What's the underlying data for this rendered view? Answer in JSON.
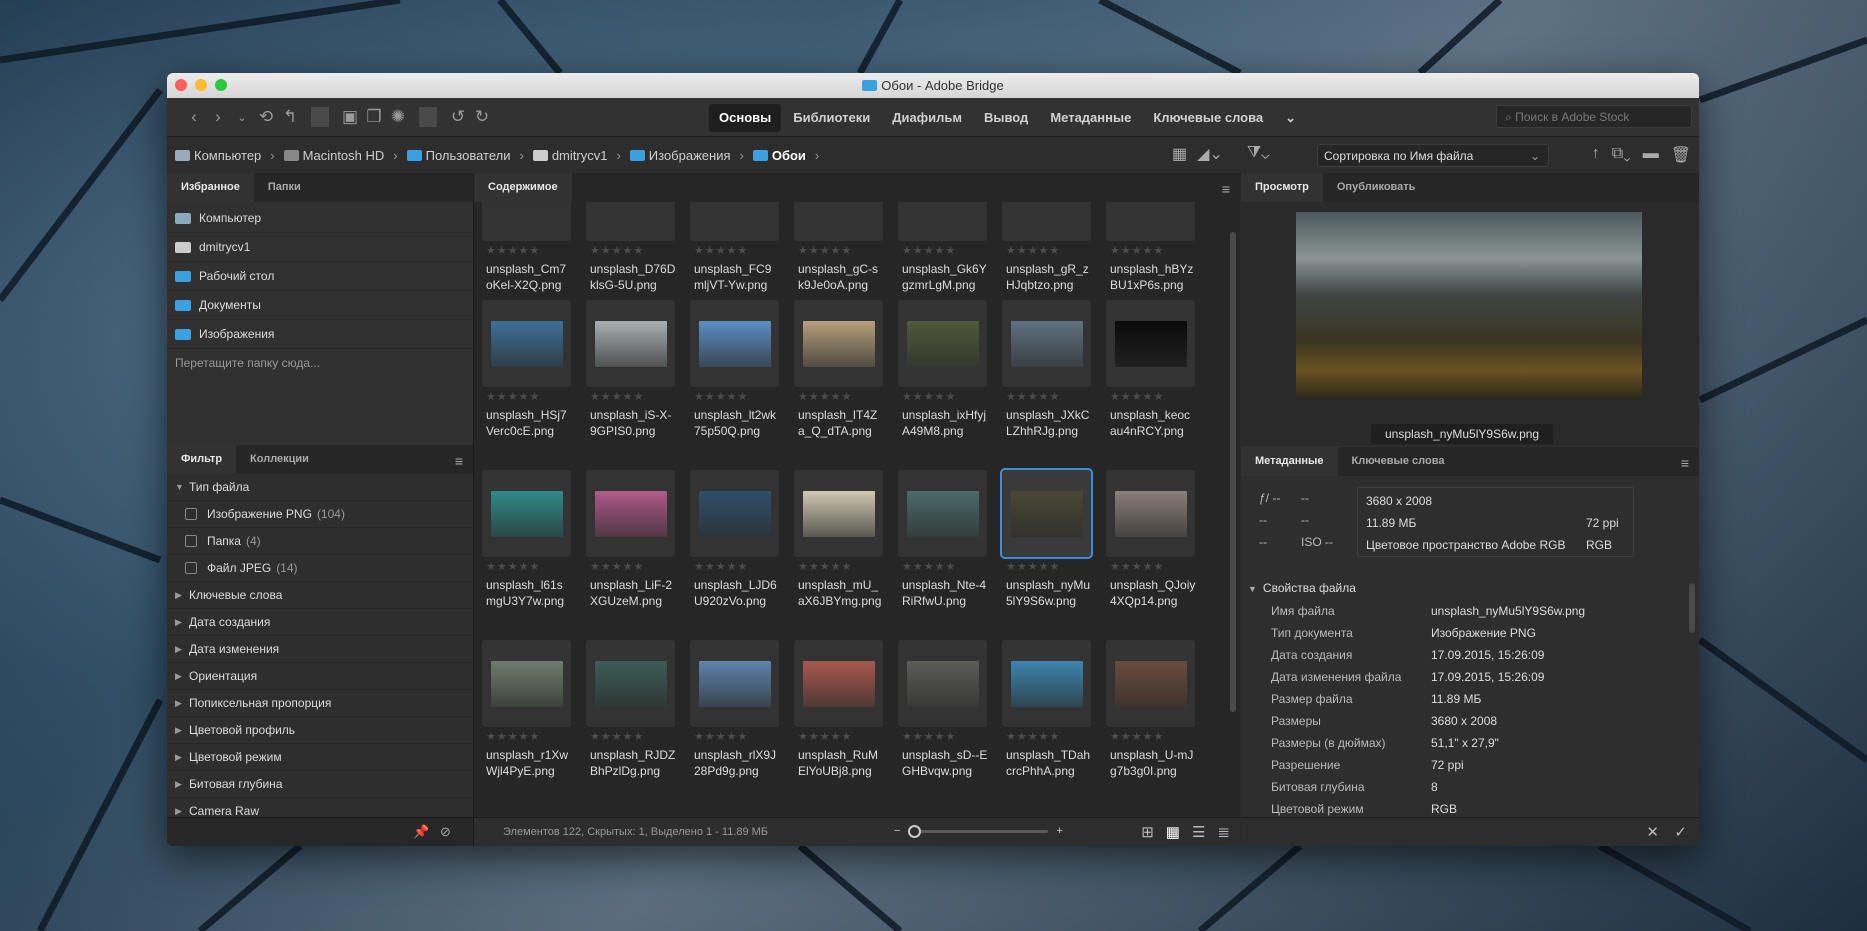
{
  "window_title": "Обои - Adobe Bridge",
  "toolbar": {
    "workspaces": [
      "Основы",
      "Библиотеки",
      "Диафильм",
      "Вывод",
      "Метаданные",
      "Ключевые слова"
    ],
    "search_placeholder": "Поиск в Adobe Stock"
  },
  "path": {
    "crumbs": [
      "Компьютер",
      "Macintosh HD",
      "Пользователи",
      "dmitrycv1",
      "Изображения",
      "Обои"
    ],
    "sort_label": "Сортировка по Имя файла"
  },
  "left": {
    "tabs": [
      "Избранное",
      "Папки"
    ],
    "favorites": [
      "Компьютер",
      "dmitrycv1",
      "Рабочий стол",
      "Документы",
      "Изображения"
    ],
    "drop_hint": "Перетащите папку сюда...",
    "filter_tabs": [
      "Фильтр",
      "Коллекции"
    ],
    "filter_section": "Тип файла",
    "filter_items": [
      {
        "label": "Изображение PNG",
        "count": "(104)"
      },
      {
        "label": "Папка",
        "count": "(4)"
      },
      {
        "label": "Файл JPEG",
        "count": "(14)"
      }
    ],
    "filter_groups": [
      "Ключевые слова",
      "Дата создания",
      "Дата изменения",
      "Ориентация",
      "Попиксельная пропорция",
      "Цветовой профиль",
      "Цветовой режим",
      "Битовая глубина",
      "Camera Raw"
    ]
  },
  "center": {
    "tab": "Содержимое",
    "rows": [
      [
        "unsplash_Cm7oKel-X2Q.png",
        "unsplash_D76DklsG-5U.png",
        "unsplash_FC9mljVT-Yw.png",
        "unsplash_gC-sk9Je0oA.png",
        "unsplash_Gk6YgzmrLgM.png",
        "unsplash_gR_zHJqbtzo.png",
        "unsplash_hBYzBU1xP6s.png"
      ],
      [
        "unsplash_HSj7Verc0cE.png",
        "unsplash_iS-X-9GPIS0.png",
        "unsplash_lt2wk75p50Q.png",
        "unsplash_IT4Za_Q_dTA.png",
        "unsplash_ixHfyjA49M8.png",
        "unsplash_JXkCLZhhRJg.png",
        "unsplash_keocau4nRCY.png"
      ],
      [
        "unsplash_l61smgU3Y7w.png",
        "unsplash_LiF-2XGUzeM.png",
        "unsplash_LJD6U920zVo.png",
        "unsplash_mU_aX6JBYmg.png",
        "unsplash_Nte-4RiRfwU.png",
        "unsplash_nyMu5lY9S6w.png",
        "unsplash_QJoiy4XQp14.png"
      ],
      [
        "unsplash_r1XwWjl4PyE.png",
        "unsplash_RJDZBhPzlDg.png",
        "unsplash_rlX9J28Pd9g.png",
        "unsplash_RuMElYoUBj8.png",
        "unsplash_sD--EGHBvqw.png",
        "unsplash_TDahcrcPhhA.png",
        "unsplash_U-mJg7b3g0I.png"
      ]
    ],
    "thumb_colors": [
      [
        "#333",
        "#333",
        "#333",
        "#333",
        "#333",
        "#333",
        "#333"
      ],
      [
        "#3d6f96",
        "#a9b0b3",
        "#5b8fc4",
        "#b59f7a",
        "#4e5a3a",
        "#5f7180",
        "#0a0a0a"
      ],
      [
        "#2f8b8a",
        "#b05a8a",
        "#2f4f6b",
        "#cfc8b0",
        "#4b6a6a",
        "#4a4733",
        "#8b8078"
      ],
      [
        "#6d7d6c",
        "#3c5c57",
        "#5f83ad",
        "#a8584d",
        "#5b5b58",
        "#3c86b0",
        "#6b4c3c"
      ]
    ],
    "selected": "unsplash_nyMu5lY9S6w.png",
    "status": "Элементов 122, Скрытых: 1, Выделено 1 - 11.89 МБ"
  },
  "right": {
    "tabs": [
      "Просмотр",
      "Опубликовать"
    ],
    "preview_name": "unsplash_nyMu5lY9S6w.png",
    "meta_tabs": [
      "Метаданные",
      "Ключевые слова"
    ],
    "exif": {
      "f": "ƒ/ --",
      "f2": "--",
      "a": "--",
      "b": "--",
      "c": "--",
      "iso": "ISO --"
    },
    "info": {
      "dims": "3680 x 2008",
      "size": "11.89 МБ",
      "ppi": "72 ppi",
      "space": "Цветовое пространство Adobe RGB",
      "mode": "RGB"
    },
    "file_props_title": "Свойства файла",
    "file_props": [
      {
        "k": "Имя файла",
        "v": "unsplash_nyMu5lY9S6w.png"
      },
      {
        "k": "Тип документа",
        "v": "Изображение PNG"
      },
      {
        "k": "Дата создания",
        "v": "17.09.2015, 15:26:09"
      },
      {
        "k": "Дата изменения файла",
        "v": "17.09.2015, 15:26:09"
      },
      {
        "k": "Размер файла",
        "v": "11.89 МБ"
      },
      {
        "k": "Размеры",
        "v": "3680 x 2008"
      },
      {
        "k": "Размеры (в дюймах)",
        "v": "51,1\" x 27,9\""
      },
      {
        "k": "Разрешение",
        "v": "72 ppi"
      },
      {
        "k": "Битовая глубина",
        "v": "8"
      },
      {
        "k": "Цветовой режим",
        "v": "RGB"
      }
    ]
  }
}
